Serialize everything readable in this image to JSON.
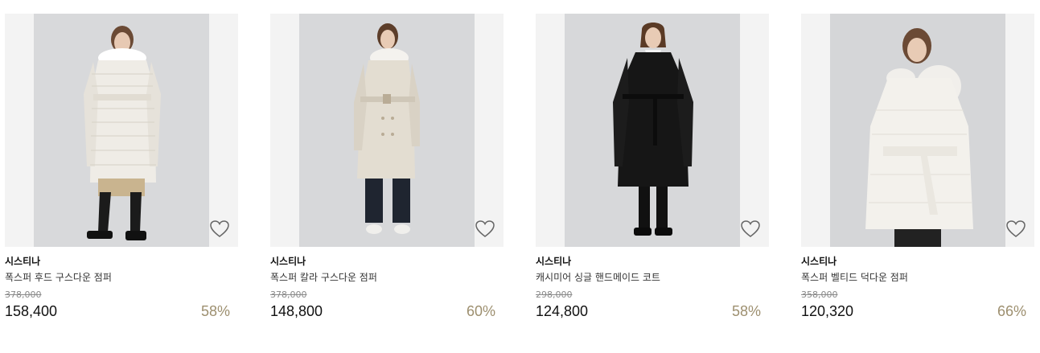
{
  "accent_color": "#9d8f6f",
  "products": [
    {
      "brand": "시스티나",
      "name": "폭스퍼 후드 구스다운 점퍼",
      "original_price": "378,000",
      "sale_price": "158,400",
      "discount": "58%",
      "wishlist_icon": "heart-outline-icon",
      "coat_color": "#efece6",
      "coat_style": "long-puffer"
    },
    {
      "brand": "시스티나",
      "name": "폭스퍼 칼라 구스다운 점퍼",
      "original_price": "378,000",
      "sale_price": "148,800",
      "discount": "60%",
      "wishlist_icon": "heart-outline-icon",
      "coat_color": "#e3ddd1",
      "coat_style": "trench-down"
    },
    {
      "brand": "시스티나",
      "name": "캐시미어 싱글 핸드메이드 코트",
      "original_price": "298,000",
      "sale_price": "124,800",
      "discount": "58%",
      "wishlist_icon": "heart-outline-icon",
      "coat_color": "#161616",
      "coat_style": "wool-coat"
    },
    {
      "brand": "시스티나",
      "name": "폭스퍼 벨티드 덕다운 점퍼",
      "original_price": "358,000",
      "sale_price": "120,320",
      "discount": "66%",
      "wishlist_icon": "heart-outline-icon",
      "coat_color": "#f3f1ec",
      "coat_style": "short-puffer"
    }
  ]
}
